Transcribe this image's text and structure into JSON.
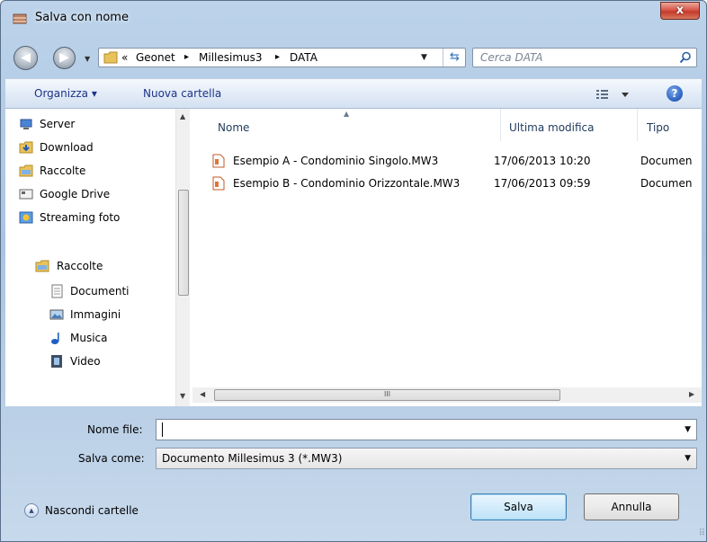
{
  "window": {
    "title": "Salva con nome",
    "close_label": "x"
  },
  "nav": {
    "back_arrow": "◀",
    "forward_arrow": "▶",
    "breadcrumb_prefix": "«",
    "breadcrumb": [
      "Geonet",
      "Millesimus3",
      "DATA"
    ],
    "separator": "▸"
  },
  "search": {
    "placeholder": "Cerca DATA"
  },
  "toolbar": {
    "organize_label": "Organizza ▾",
    "new_folder_label": "Nuova cartella"
  },
  "sidebar": {
    "items": [
      {
        "label": "Server",
        "icon": "server-icon"
      },
      {
        "label": "Download",
        "icon": "download-folder-icon"
      },
      {
        "label": "Raccolte",
        "icon": "libraries-icon"
      },
      {
        "label": "Google Drive",
        "icon": "google-drive-icon"
      },
      {
        "label": "Streaming foto",
        "icon": "photo-stream-icon"
      }
    ],
    "libraries_header": "Raccolte",
    "libraries": [
      {
        "label": "Documenti",
        "icon": "documents-icon"
      },
      {
        "label": "Immagini",
        "icon": "pictures-icon"
      },
      {
        "label": "Musica",
        "icon": "music-icon"
      },
      {
        "label": "Video",
        "icon": "video-icon"
      }
    ]
  },
  "file_list": {
    "columns": [
      "Nome",
      "Ultima modifica",
      "Tipo"
    ],
    "rows": [
      {
        "name": "Esempio A - Condominio Singolo.MW3",
        "modified": "17/06/2013 10:20",
        "type": "Documen"
      },
      {
        "name": "Esempio B - Condominio Orizzontale.MW3",
        "modified": "17/06/2013 09:59",
        "type": "Documen"
      }
    ],
    "scroll_grip": "III"
  },
  "form": {
    "filename_label": "Nome file:",
    "filename_value": "",
    "savetype_label": "Salva come:",
    "savetype_value": "Documento Millesimus 3 (*.MW3)"
  },
  "footer": {
    "hide_folders_label": "Nascondi cartelle",
    "save_label": "Salva",
    "cancel_label": "Annulla"
  },
  "colors": {
    "link_text": "#1e3287",
    "primary_border": "#3c7fb1",
    "close_red": "#c33b2b"
  }
}
